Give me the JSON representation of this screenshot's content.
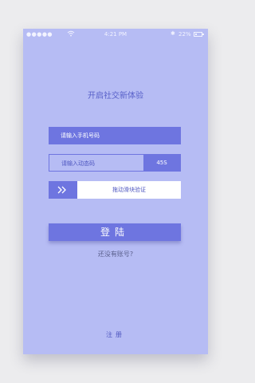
{
  "status_bar": {
    "signal": "●●●●●",
    "time": "4:21 PM",
    "bluetooth": "✱",
    "battery_percent": "22%",
    "battery_level": 0.22
  },
  "slogan": "开启社交新体验",
  "phone_input": {
    "placeholder": "请输入手机号码"
  },
  "code_input": {
    "placeholder": "请输入动态码",
    "countdown": "45S"
  },
  "slider": {
    "label": "拖动滑块验证",
    "handle_icon": "double-chevron-right-icon"
  },
  "login_button": {
    "label": "登陆"
  },
  "no_account_link": "还没有账号?",
  "register_link": "注册",
  "colors": {
    "background": "#b6bcf4",
    "accent": "#6e75e0",
    "text_accent": "#4f57c0"
  }
}
